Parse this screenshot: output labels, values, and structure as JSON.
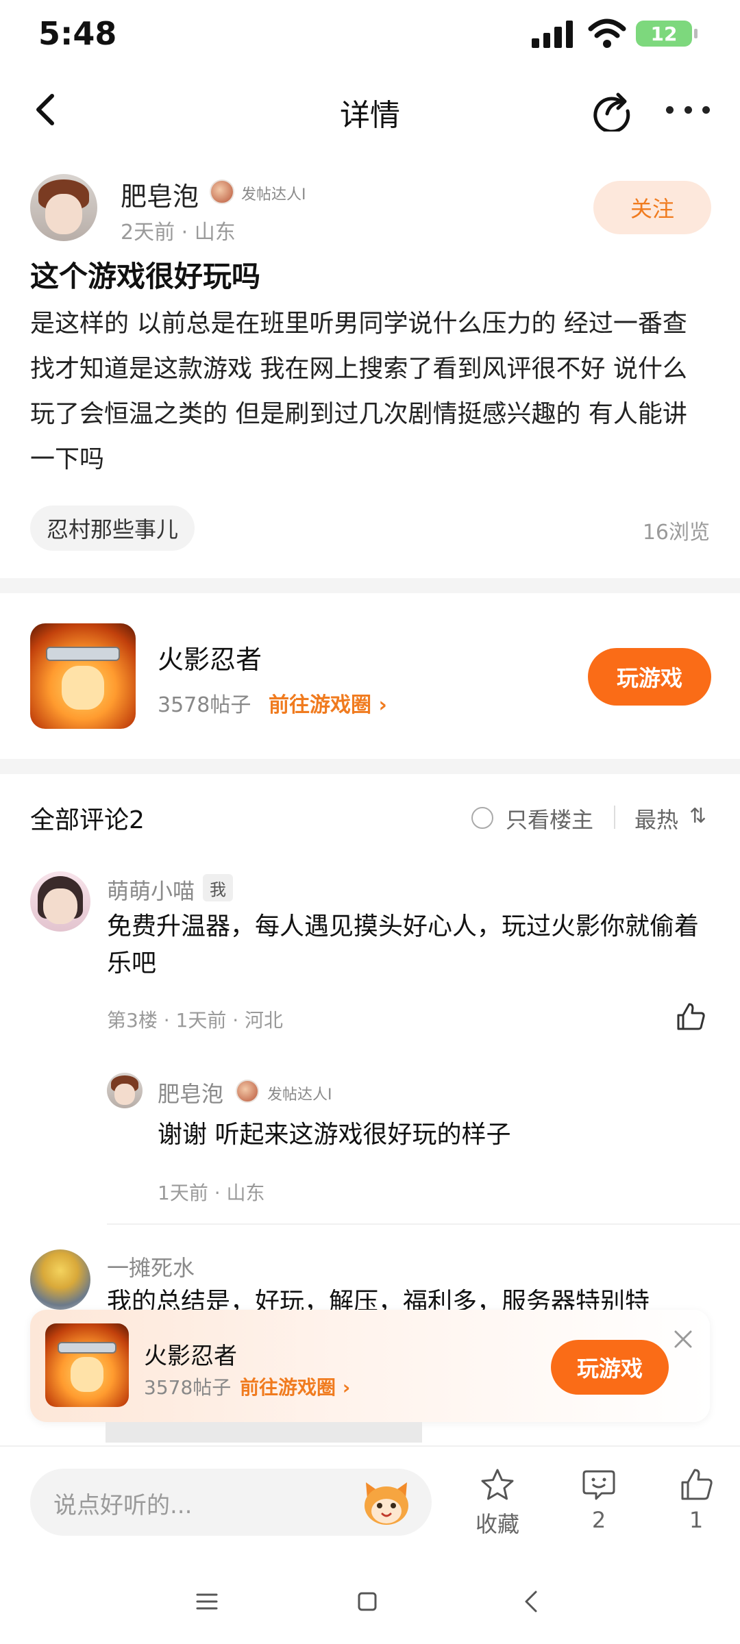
{
  "status_bar": {
    "time": "5:48",
    "battery": "12"
  },
  "nav": {
    "title": "详情"
  },
  "post": {
    "author": {
      "name": "肥皂泡",
      "badge": "发帖达人I",
      "meta": "2天前 · 山东"
    },
    "follow_label": "关注",
    "title": "这个游戏很好玩吗",
    "body": "是这样的 以前总是在班里听男同学说什么压力的 经过一番查找才知道是这款游戏 我在网上搜索了看到风评很不好 说什么玩了会恒温之类的 但是刷到过几次剧情挺感兴趣的 有人能讲一下吗",
    "topic": "忍村那些事儿",
    "views": "16浏览"
  },
  "game_card": {
    "name": "火影忍者",
    "posts": "3578帖子",
    "link": "前往游戏圈",
    "play_label": "玩游戏"
  },
  "comments_section": {
    "title": "全部评论2",
    "only_op": "只看楼主",
    "sort": "最热",
    "sort_icon": "⇅"
  },
  "comments": [
    {
      "name": "萌萌小喵",
      "me_tag": "我",
      "text": "免费升温器，每人遇见摸头好心人，玩过火影你就偷着乐吧",
      "meta": "第3楼 · 1天前 · 河北"
    },
    {
      "name": "一摊死水",
      "text": "我的总结是，好玩，解压，福利多，服务器特别特"
    }
  ],
  "reply": {
    "name": "肥皂泡",
    "badge": "发帖达人I",
    "text": "谢谢 听起来这游戏很好玩的样子",
    "meta": "1天前 · 山东"
  },
  "float_banner": {
    "name": "火影忍者",
    "posts": "3578帖子",
    "link": "前往游戏圈",
    "play_label": "玩游戏"
  },
  "bottom_bar": {
    "input_placeholder": "说点好听的...",
    "favorite_label": "收藏",
    "comment_count": "2",
    "like_count": "1"
  },
  "colors": {
    "accent": "#fa6c17",
    "accent_text": "#f07b1f",
    "follow_bg": "#fde8dc"
  }
}
